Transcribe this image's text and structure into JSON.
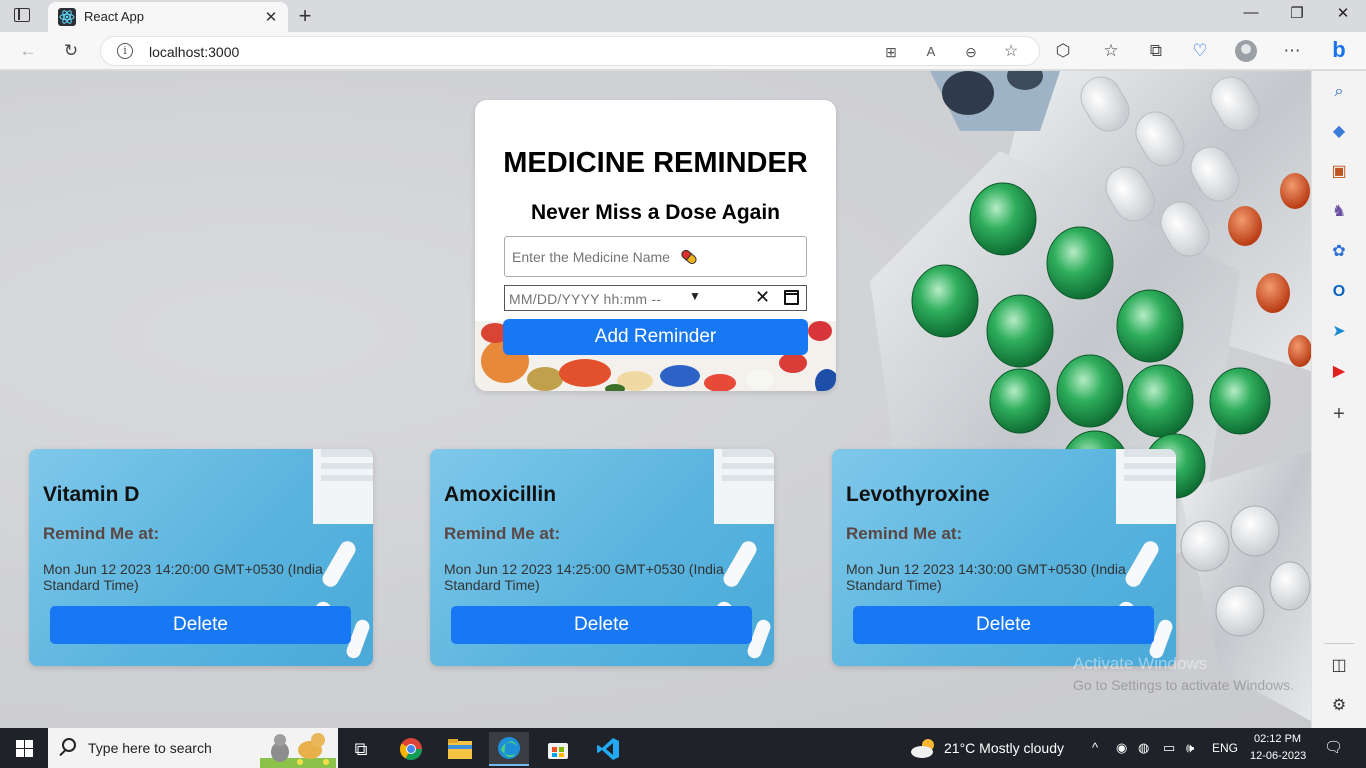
{
  "browser": {
    "tab_title": "React App",
    "tab_close": "✕",
    "new_tab": "+",
    "url": "localhost:3000",
    "window_controls": {
      "minimize": "—",
      "maximize": "❐",
      "close": "✕"
    }
  },
  "app": {
    "title": "MEDICINE REMINDER",
    "subtitle": "Never Miss a Dose Again",
    "medicine_input_placeholder": "Enter the Medicine Name",
    "datetime_placeholder": "MM/DD/YYYY  hh:mm  --",
    "add_button": "Add Reminder"
  },
  "reminders": [
    {
      "name": "Vitamin D",
      "remind_label": "Remind Me at:",
      "time": "Mon Jun 12 2023 14:20:00 GMT+0530 (India Standard Time)",
      "delete_label": "Delete"
    },
    {
      "name": "Amoxicillin",
      "remind_label": "Remind Me at:",
      "time": "Mon Jun 12 2023 14:25:00 GMT+0530 (India Standard Time)",
      "delete_label": "Delete"
    },
    {
      "name": "Levothyroxine",
      "remind_label": "Remind Me at:",
      "time": "Mon Jun 12 2023 14:30:00 GMT+0530 (India Standard Time)",
      "delete_label": "Delete"
    }
  ],
  "watermark": {
    "line1": "Activate Windows",
    "line2": "Go to Settings to activate Windows."
  },
  "taskbar": {
    "search_placeholder": "Type here to search",
    "weather": "21°C  Mostly cloudy",
    "language": "ENG",
    "time": "02:12 PM",
    "date": "12-06-2023"
  },
  "colors": {
    "accent": "#1877f2",
    "card_blue": "#5ab4de",
    "pill_green": "#1f9a4a"
  }
}
